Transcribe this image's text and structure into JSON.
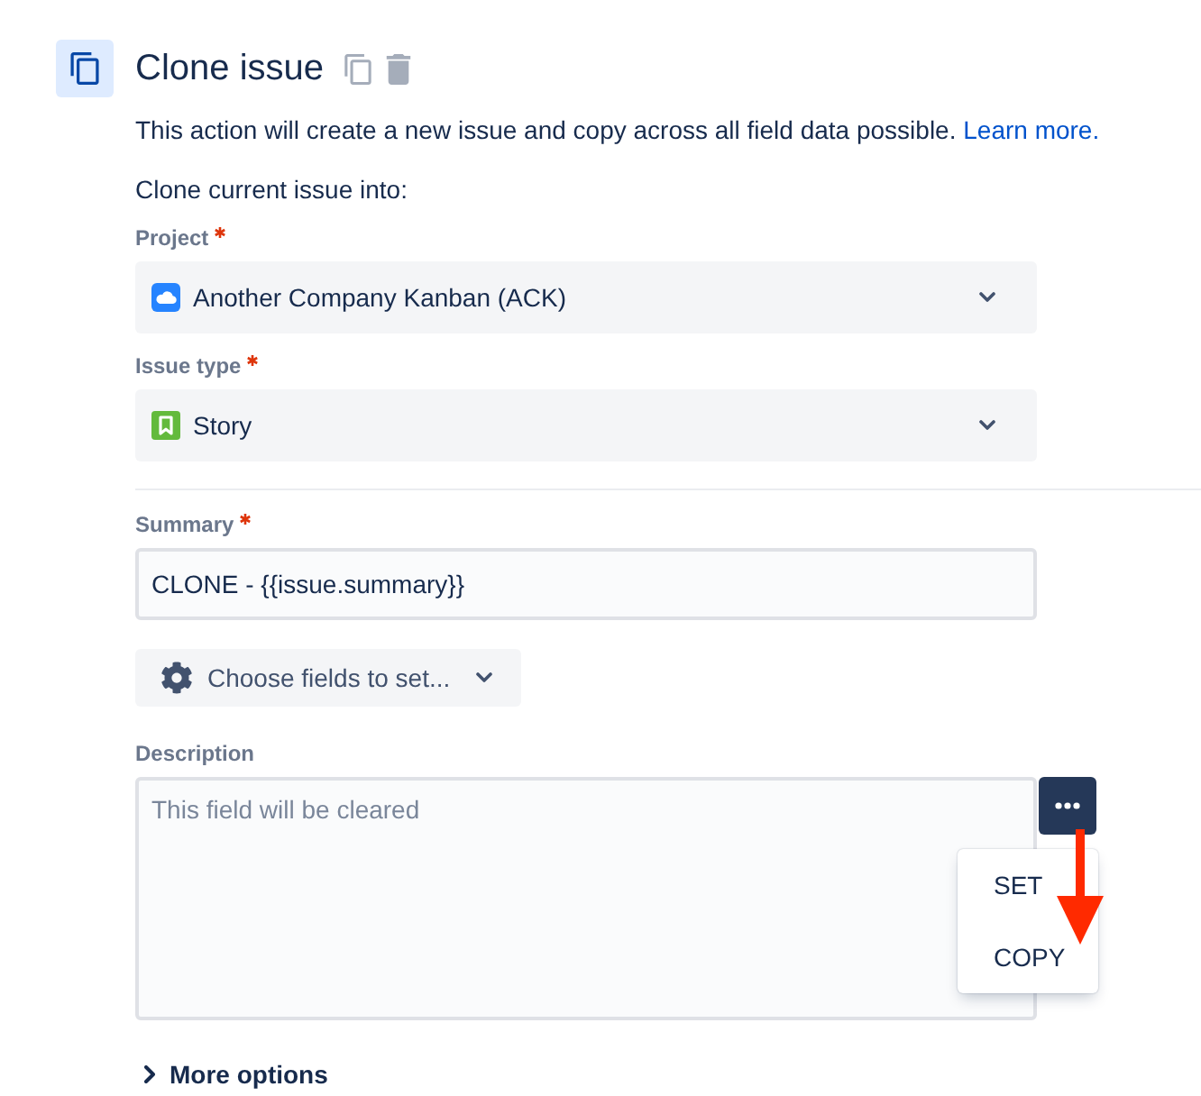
{
  "header": {
    "title": "Clone issue"
  },
  "intro": {
    "text": "This action will create a new issue and copy across all field data possible.",
    "link": "Learn more."
  },
  "subheading": "Clone current issue into:",
  "project": {
    "label": "Project",
    "required": true,
    "value": "Another Company Kanban (ACK)"
  },
  "issue_type": {
    "label": "Issue type",
    "required": true,
    "value": "Story"
  },
  "summary": {
    "label": "Summary",
    "required": true,
    "value": "CLONE - {{issue.summary}}"
  },
  "choose_fields_button": {
    "label": "Choose fields to set..."
  },
  "description": {
    "label": "Description",
    "required": false,
    "placeholder": "This field will be cleared",
    "menu_open": true,
    "menu_items": [
      {
        "label": "SET"
      },
      {
        "label": "COPY"
      }
    ]
  },
  "more_options": {
    "label": "More options",
    "expanded": false
  }
}
